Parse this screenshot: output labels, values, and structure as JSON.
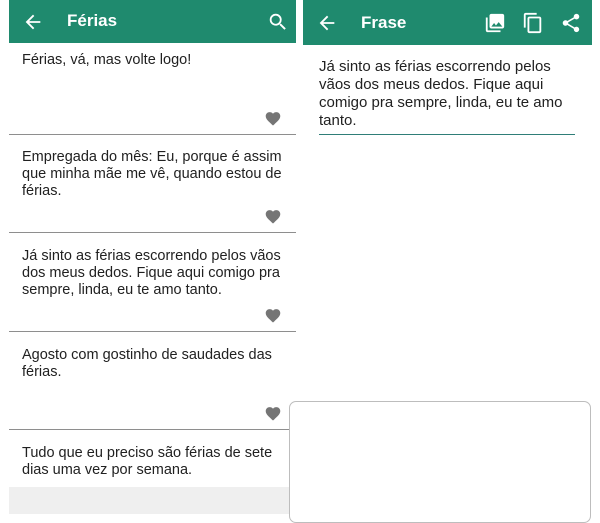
{
  "left_screen": {
    "title": "Férias",
    "items": [
      {
        "text": "Férias, vá, mas volte logo!"
      },
      {
        "text": "Empregada do mês: Eu, porque é assim que minha mãe me vê, quando estou de férias."
      },
      {
        "text": "Já sinto as férias escorrendo pelos vãos dos meus dedos. Fique aqui comigo pra sempre, linda, eu te amo tanto."
      },
      {
        "text": "Agosto com gostinho de saudades das férias."
      },
      {
        "text": "Tudo que eu preciso são férias de sete dias uma vez por semana."
      }
    ]
  },
  "right_screen": {
    "title": "Frase",
    "phrase": "Já sinto as férias escorrendo pelos vãos dos meus dedos. Fique aqui comigo pra sempre, linda, eu te amo tanto."
  },
  "colors": {
    "app_bar": "#1f8a6e",
    "heart": "#757575",
    "divider": "#8e8e8e",
    "underline": "#2f7e78"
  },
  "icons": {
    "back": "arrow-left-icon",
    "search": "search-icon",
    "image": "image-icon",
    "copy": "copy-icon",
    "share": "share-icon",
    "favorite": "heart-icon"
  }
}
